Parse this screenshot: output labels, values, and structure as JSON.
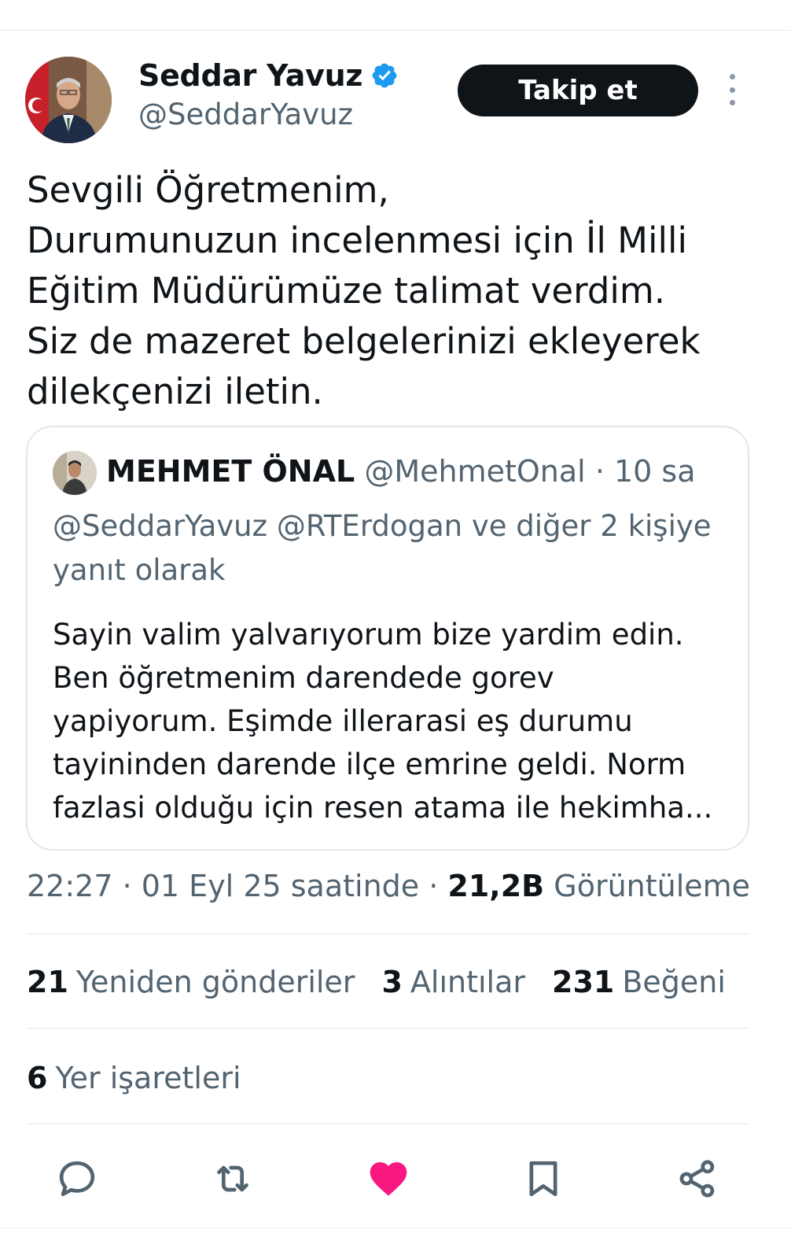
{
  "author": {
    "name": "Seddar Yavuz",
    "handle": "@SeddarYavuz",
    "verified": true
  },
  "follow_label": "Takip et",
  "tweet_lines": [
    "Sevgili Öğretmenim,",
    "Durumunuzun incelenmesi için İl Milli",
    "Eğitim Müdürümüze talimat verdim.",
    "Siz de mazeret belgelerinizi ekleyerek",
    "dilekçenizi iletin."
  ],
  "quote": {
    "name": "MEHMET ÖNAL",
    "handle": "@MehmetOnal",
    "time": "· 10 sa",
    "reply_context": "@SeddarYavuz @RTErdogan ve diğer 2 kişiye yanıt olarak",
    "body_lines": [
      "Sayin valim yalvarıyorum bize yardim edin.",
      "Ben öğretmenim darendede gorev",
      "yapiyorum. Eşimde illerarasi eş durumu",
      "tayininden darende ilçe emrine geldi. Norm",
      "fazlasi olduğu için resen atama ile hekimha..."
    ]
  },
  "meta": {
    "timestamp": "22:27 · 01 Eyl 25 saatinde ·",
    "views_count": "21,2B",
    "views_label": "Görüntüleme"
  },
  "stats": {
    "reposts_count": "21",
    "reposts_label": "Yeniden gönderiler",
    "quotes_count": "3",
    "quotes_label": "Alıntılar",
    "likes_count": "231",
    "likes_label": "Beğeni",
    "bookmarks_count": "6",
    "bookmarks_label": "Yer işaretleri"
  },
  "actions": [
    "reply-icon",
    "repost-icon",
    "like-icon",
    "bookmark-icon",
    "share-icon"
  ],
  "colors": {
    "accent_blue": "#1d9bf0",
    "like_pink": "#f91880",
    "text_primary": "#0f1419",
    "text_secondary": "#536471"
  }
}
